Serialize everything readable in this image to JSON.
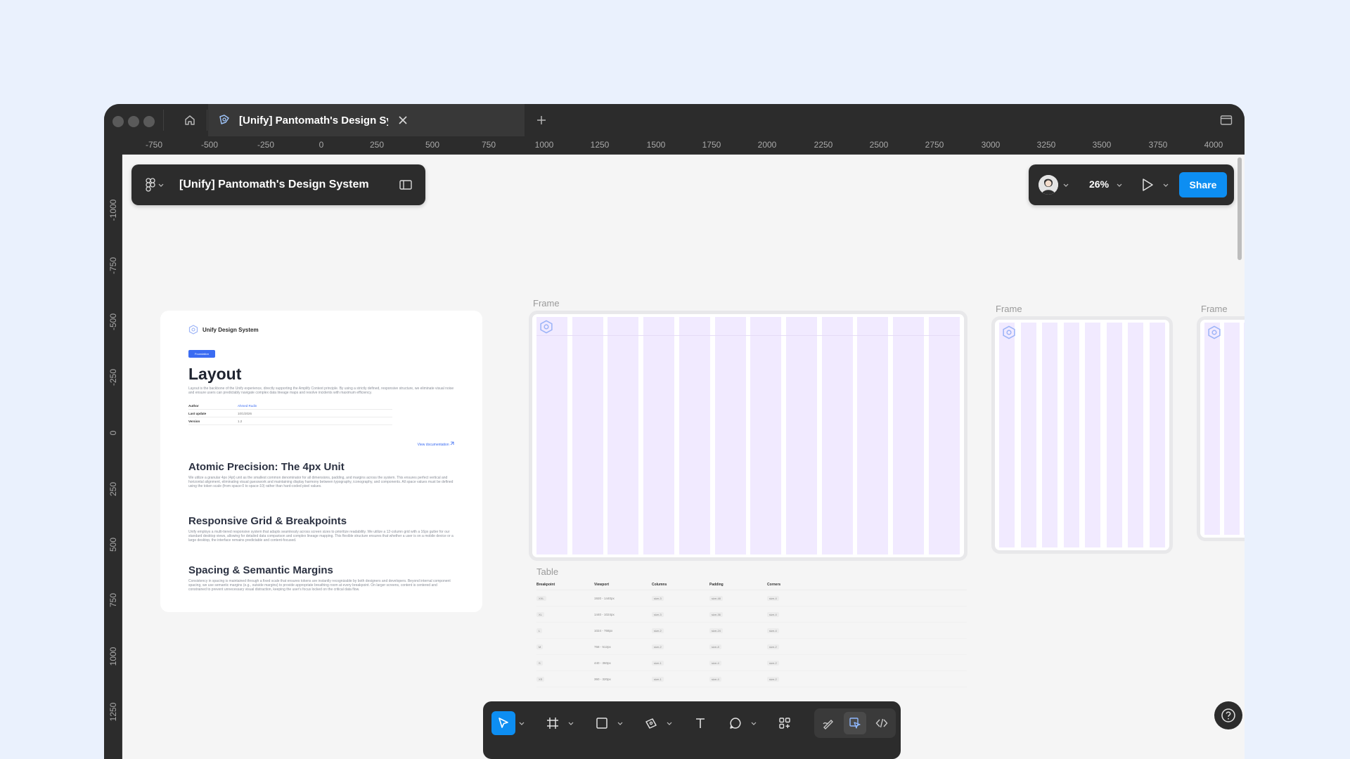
{
  "tab": {
    "title": "[Unify] Pantomath's Design System"
  },
  "ruler": {
    "horizontal": [
      "-750",
      "-500",
      "-250",
      "0",
      "250",
      "500",
      "750",
      "1000",
      "1250",
      "1500",
      "1750",
      "2000",
      "2250",
      "2500",
      "2750",
      "3000",
      "3250",
      "3500",
      "3750",
      "4000"
    ],
    "vertical": [
      "-1000",
      "-750",
      "-500",
      "-250",
      "0",
      "250",
      "500",
      "750",
      "1000",
      "1250"
    ]
  },
  "file": {
    "name": "[Unify] Pantomath's Design System"
  },
  "toolbar_right": {
    "zoom": "26%",
    "share_label": "Share"
  },
  "doc": {
    "brand": "Unify Design System",
    "tag": "Foundation",
    "title": "Layout",
    "intro": "Layout is the backbone of the Unify experience, directly supporting the Amplify Context principle. By using a strictly defined, responsive structure, we eliminate visual noise and ensure users can predictably navigate complex data lineage maps and resolve incidents with maximum efficiency.",
    "meta": [
      {
        "key": "Author",
        "value": "Ahmed Rudin",
        "link": true
      },
      {
        "key": "Last update",
        "value": "10/1/2026",
        "link": false
      },
      {
        "key": "Version",
        "value": "1.2",
        "link": false
      }
    ],
    "doc_link": "View documentation",
    "sections": [
      {
        "heading": "Atomic Precision: The 4px Unit",
        "body": "We utilize a granular 4px (4pt) unit as the smallest common denominator for all dimensions, padding, and margins across the system. This ensures perfect vertical and horizontal alignment, eliminating visual guesswork and maintaining display harmony between typography, iconography, and components. All space values must be defined using the token scale (from space-0 to space-10) rather than hard-coded pixel values."
      },
      {
        "heading": "Responsive Grid & Breakpoints",
        "body": "Unify employs a multi-tiered responsive system that adapts seamlessly across screen sizes to prioritize readability. We utilize a 12-column grid with a 16px gutter for our standard desktop views, allowing for detailed data comparison and complex lineage mapping. This flexible structure ensures that whether a user is on a mobile device or a large desktop, the interface remains predictable and content-focused."
      },
      {
        "heading": "Spacing & Semantic Margins",
        "body": "Consistency in spacing is maintained through a fixed scale that ensures tokens are instantly recognizable by both designers and developers. Beyond internal component spacing, we use semantic margins (e.g., outside margins) to provide appropriate breathing room at every breakpoint. On larger screens, content is centered and constrained to prevent unnecessary visual distraction, keeping the user's focus locked on the critical data flow."
      }
    ]
  },
  "frames": [
    {
      "label": "Frame"
    },
    {
      "label": "Frame"
    },
    {
      "label": "Frame"
    }
  ],
  "table": {
    "label": "Table",
    "headers": [
      "Breakpoint",
      "Viewport",
      "Columns",
      "Padding",
      "Corners"
    ],
    "rows": [
      [
        "XXL",
        "1920 - 1440px",
        "size-3",
        "size-48",
        "size-4"
      ],
      [
        "XL",
        "1440 - 1024px",
        "size-3",
        "size-36",
        "size-4"
      ],
      [
        "L",
        "1024 - 768px",
        "size-2",
        "size-24",
        "size-4"
      ],
      [
        "M",
        "768 - 512px",
        "size-2",
        "size-8",
        "size-2"
      ],
      [
        "S",
        "440 - 360px",
        "size-1",
        "size-4",
        "size-2"
      ],
      [
        "XS",
        "360 - 320px",
        "size-1",
        "size-4",
        "size-2"
      ]
    ]
  },
  "colors": {
    "accent": "#0d8ef2",
    "chrome": "#2c2c2c",
    "canvas": "#f5f5f5",
    "grid_column": "#f1eaff",
    "doc_tag": "#3b6cf2"
  }
}
